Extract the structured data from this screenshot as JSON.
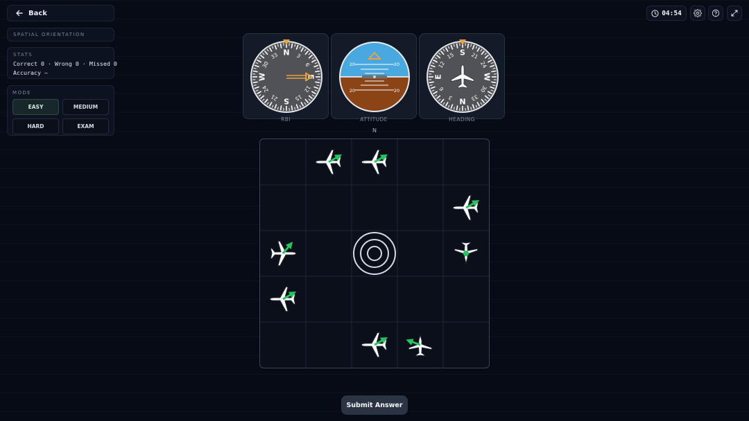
{
  "back": {
    "label": "Back"
  },
  "app_title": "SPATIAL ORIENTATION",
  "stats": {
    "heading": "STATS",
    "line1": "Correct 0 · Wrong 0 · Missed 0",
    "line2": "Accuracy —"
  },
  "mode": {
    "heading": "MODE",
    "options": [
      "EASY",
      "MEDIUM",
      "HARD",
      "EXAM"
    ],
    "selected": "EASY"
  },
  "timer": {
    "value": "04:54"
  },
  "toolbar_icons": [
    "clock-icon",
    "gear-icon",
    "help-icon",
    "fullscreen-icon"
  ],
  "instruments": {
    "rbi": {
      "label": "RBI",
      "bearing_deg": 90
    },
    "attitude": {
      "label": "ATTITUDE",
      "pitch_labels": [
        "20",
        "20",
        "20",
        "20"
      ]
    },
    "heading": {
      "label": "HEADING",
      "heading_deg": 180
    },
    "dial_labels": [
      "N",
      "3",
      "6",
      "E",
      "12",
      "15",
      "S",
      "21",
      "24",
      "W",
      "30",
      "33"
    ]
  },
  "grid": {
    "north_label": "N",
    "size": 5,
    "aircraft": [
      {
        "row": 0,
        "col": 1,
        "view": "side-left",
        "arrow_deg": -30
      },
      {
        "row": 0,
        "col": 2,
        "view": "side-left",
        "arrow_deg": -30
      },
      {
        "row": 1,
        "col": 4,
        "view": "side-left",
        "arrow_deg": -30
      },
      {
        "row": 2,
        "col": 0,
        "view": "side-right",
        "arrow_deg": -50
      },
      {
        "row": 2,
        "col": 4,
        "view": "front",
        "arrow_deg": null
      },
      {
        "row": 3,
        "col": 0,
        "view": "side-left",
        "arrow_deg": -30
      },
      {
        "row": 4,
        "col": 2,
        "view": "side-left",
        "arrow_deg": -30
      },
      {
        "row": 4,
        "col": 3,
        "view": "rear",
        "arrow_deg": 200
      }
    ]
  },
  "colors": {
    "background": "#070b16",
    "panel": "#0d1220",
    "arrow_green": "#22c55e",
    "needle_orange": "#f0a03c",
    "sky": "#4aa8e0",
    "ground": "#8a4416"
  },
  "submit": {
    "label": "Submit Answer"
  }
}
